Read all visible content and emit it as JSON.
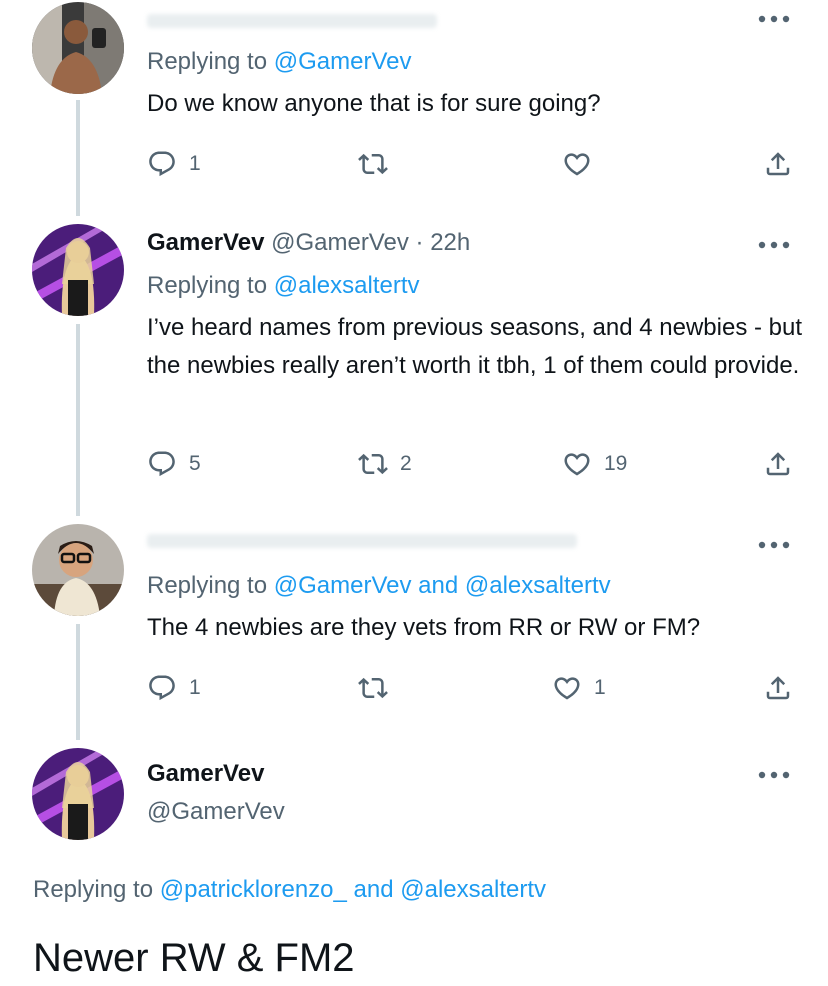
{
  "tweets": [
    {
      "reply_prefix": "Replying to",
      "reply_to": [
        "@GamerVev"
      ],
      "text": "Do we know anyone that is for sure going?",
      "actions": {
        "reply": "1",
        "retweet": "",
        "like": "",
        "share": ""
      }
    },
    {
      "name": "GamerVev",
      "handle": "@GamerVev",
      "separator": "·",
      "time": "22h",
      "reply_prefix": "Replying to",
      "reply_to": [
        "@alexsaltertv"
      ],
      "text": "I’ve heard names from previous seasons, and 4 newbies - but the newbies really aren’t worth it tbh, 1 of them could provide.",
      "actions": {
        "reply": "5",
        "retweet": "2",
        "like": "19",
        "share": ""
      }
    },
    {
      "reply_prefix": "Replying to",
      "reply_to": [
        "@GamerVev",
        "@alexsaltertv"
      ],
      "conjunction": "and",
      "text": "The 4 newbies are they vets from RR or RW or FM?",
      "actions": {
        "reply": "1",
        "retweet": "",
        "like": "1",
        "share": ""
      }
    }
  ],
  "main_tweet": {
    "name": "GamerVev",
    "handle": "@GamerVev",
    "reply_prefix": "Replying to",
    "reply_to": [
      "@patricklorenzo_",
      "@alexsaltertv"
    ],
    "conjunction": "and",
    "text": "Newer RW & FM2"
  },
  "icons": [
    "reply-icon",
    "retweet-icon",
    "like-icon",
    "share-icon",
    "more-options-icon"
  ],
  "colors": {
    "link": "#1d9bf0",
    "secondary_text": "#536471",
    "primary_text": "#0f1419",
    "thread_line": "#cfd9de"
  }
}
